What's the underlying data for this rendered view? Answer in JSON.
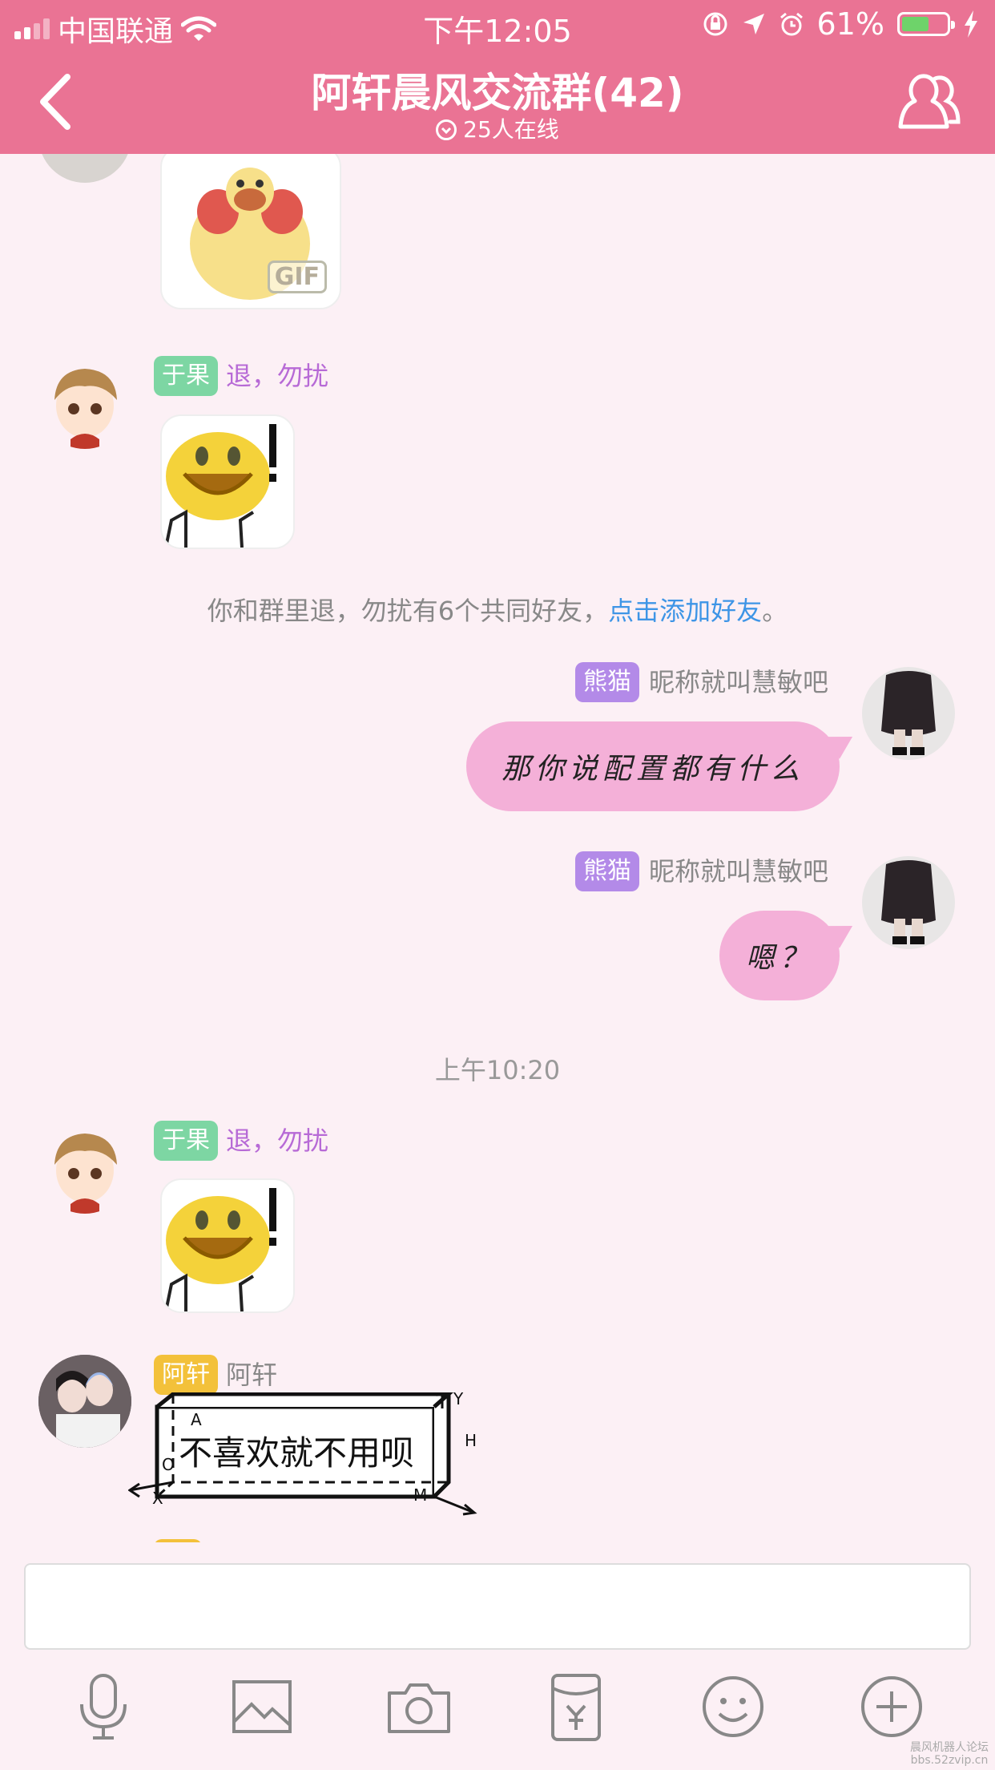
{
  "status_bar": {
    "carrier": "中国联通",
    "time": "下午12:05",
    "battery_percent": "61%",
    "battery_level": 0.61
  },
  "header": {
    "title": "阿轩晨风交流群(42)",
    "online": "25人在线"
  },
  "messages": [
    {
      "type": "sticker",
      "sticker": "gif-chick",
      "gif_label": "GIF"
    },
    {
      "type": "sticker",
      "tag": "于果",
      "name": "退，勿扰",
      "sticker": "smiley-exclaim"
    },
    {
      "type": "system",
      "text": "你和群里退，勿扰有6个共同好友，",
      "link": "点击添加好友",
      "end": "。"
    },
    {
      "type": "text",
      "tag": "熊猫",
      "name": "昵称就叫慧敏吧",
      "text": "那你说配置都有什么"
    },
    {
      "type": "text",
      "tag": "熊猫",
      "name": "昵称就叫慧敏吧",
      "text": "嗯？"
    },
    {
      "type": "time",
      "text": "上午10:20"
    },
    {
      "type": "sticker",
      "tag": "于果",
      "name": "退，勿扰",
      "sticker": "smiley-exclaim"
    },
    {
      "type": "box",
      "tag": "阿轩",
      "name": "阿轩",
      "text": "不喜欢就不用呗",
      "axis_labels": [
        "A",
        "Y",
        "H",
        "O",
        "X",
        "M"
      ]
    }
  ],
  "toolbar": [
    "microphone-icon",
    "image-icon",
    "camera-icon",
    "red-packet-icon",
    "emoji-icon",
    "plus-icon"
  ],
  "watermark": [
    "晨风机器人论坛",
    "bbs.52zvip.cn"
  ],
  "colors": {
    "header": "#ea7394",
    "background": "#fcf0f5",
    "bubble": "#f4b0d8",
    "link": "#3e95e6"
  }
}
